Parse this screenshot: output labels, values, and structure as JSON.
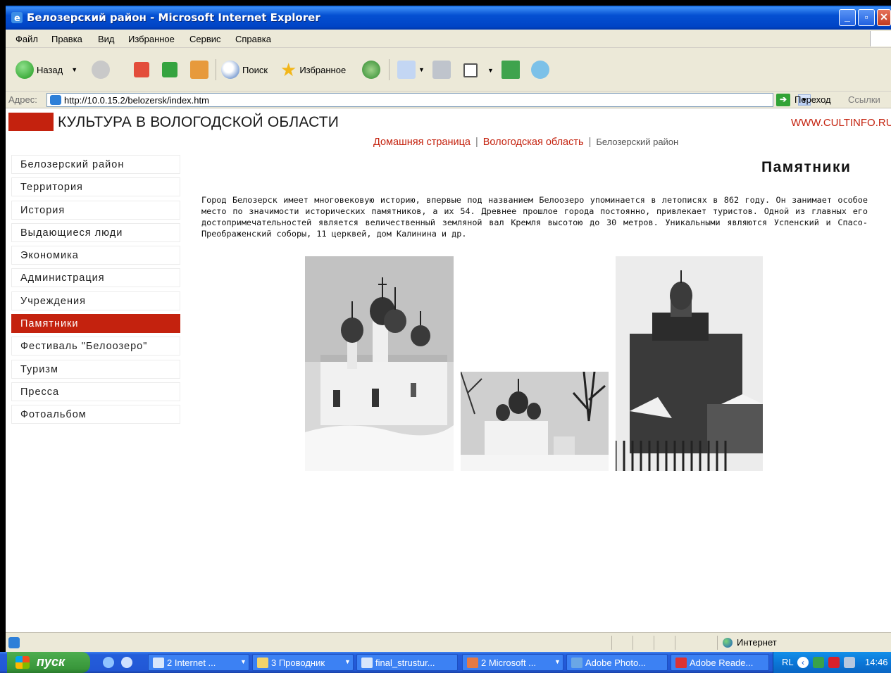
{
  "window": {
    "title": "Белозерский район - Microsoft Internet Explorer"
  },
  "menubar": {
    "items": [
      "Файл",
      "Правка",
      "Вид",
      "Избранное",
      "Сервис",
      "Справка"
    ]
  },
  "toolbar": {
    "back": "Назад",
    "search": "Поиск",
    "favorites": "Избранное"
  },
  "addressbar": {
    "label": "Адрес:",
    "url": "http://10.0.15.2/belozersk/index.htm",
    "go": "Переход",
    "links": "Ссылки"
  },
  "site": {
    "title": "КУЛЬТУРА В ВОЛОГОДСКОЙ ОБЛАСТИ",
    "url": "WWW.CULTINFO.RU",
    "brand_color": "#c4220e"
  },
  "breadcrumb": {
    "home": "Домашняя страница",
    "region": "Вологодская область",
    "current": "Белозерский район"
  },
  "sidemenu": {
    "items": [
      {
        "label": "Белозерский район",
        "active": false
      },
      {
        "label": "Территория",
        "active": false
      },
      {
        "label": "История",
        "active": false
      },
      {
        "label": "Выдающиеся люди",
        "active": false
      },
      {
        "label": "Экономика",
        "active": false
      },
      {
        "label": "Администрация",
        "active": false
      },
      {
        "label": "Учреждения",
        "active": false
      },
      {
        "label": "Памятники",
        "active": true
      },
      {
        "label": "Фестиваль \"Белоозеро\"",
        "active": false
      },
      {
        "label": "Туризм",
        "active": false
      },
      {
        "label": "Пресса",
        "active": false
      },
      {
        "label": "Фотоальбом",
        "active": false
      }
    ]
  },
  "page": {
    "heading": "Памятники",
    "intro": "Город Белозерск имеет многовековую историю, впервые под названием Белоозеро упоминается в летописях в 862 году. Он занимает особое место по значимости исторических памятников, а их 54. Древнее прошлое города постоянно, привлекает туристов. Одной из главных его достопримечательностей является величественный земляной вал Кремля высотою до 30 метров. Уникальными являются Успенский и Спасо-Преображенский соборы, 11 церквей, дом Калинина и др."
  },
  "statusbar": {
    "zone": "Интернет"
  },
  "taskbar": {
    "start": "пуск",
    "tasks": [
      "2 Internet ...",
      "3 Проводник",
      "final_strustur...",
      "2 Microsoft ...",
      "Adobe Photo...",
      "Adobe Reade..."
    ],
    "lang": "RL",
    "clock": "14:46"
  }
}
